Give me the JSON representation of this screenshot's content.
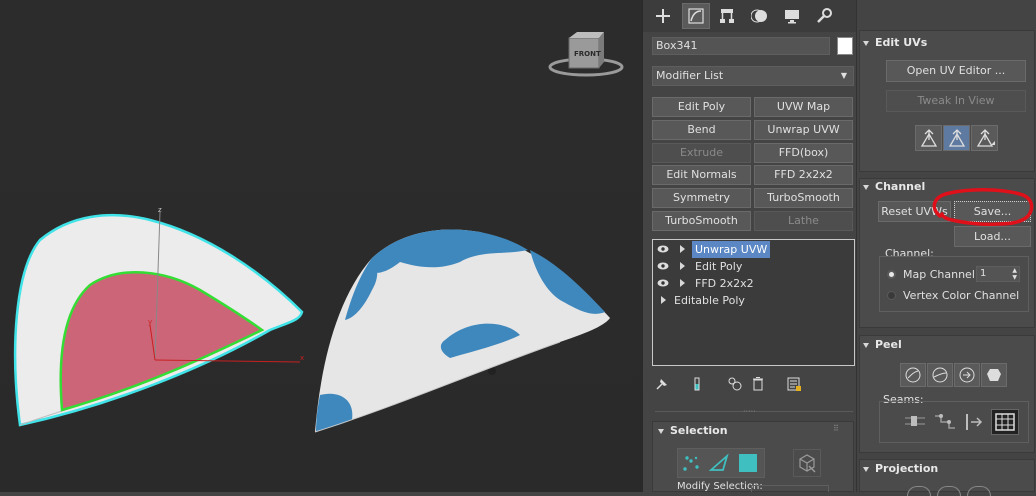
{
  "viewport": {
    "nav_cube_label": "FRONT",
    "axis_z": "z",
    "axis_x": "x",
    "axis_y": "y"
  },
  "command_panel": {
    "tabs": [
      "create",
      "modify",
      "hierarchy",
      "motion",
      "display",
      "utilities"
    ],
    "object_name": "Box341",
    "object_color": "#ffffff",
    "modifier_list_label": "Modifier List",
    "modifier_buttons": [
      {
        "label": "Edit Poly",
        "enabled": true
      },
      {
        "label": "UVW Map",
        "enabled": true
      },
      {
        "label": "Bend",
        "enabled": true
      },
      {
        "label": "Unwrap UVW",
        "enabled": true
      },
      {
        "label": "Extrude",
        "enabled": false
      },
      {
        "label": "FFD(box)",
        "enabled": true
      },
      {
        "label": "Edit Normals",
        "enabled": true
      },
      {
        "label": "FFD 2x2x2",
        "enabled": true
      },
      {
        "label": "Symmetry",
        "enabled": true
      },
      {
        "label": "TurboSmooth",
        "enabled": true
      },
      {
        "label": "TurboSmooth",
        "enabled": true
      },
      {
        "label": "Lathe",
        "enabled": false
      }
    ],
    "stack": [
      {
        "label": "Unwrap UVW",
        "selected": true,
        "eye": true
      },
      {
        "label": "Edit Poly",
        "selected": false,
        "eye": true
      },
      {
        "label": "FFD 2x2x2",
        "selected": false,
        "eye": true
      },
      {
        "label": "Editable Poly",
        "selected": false,
        "eye": false
      }
    ],
    "stack_tools": [
      "pin-stack",
      "show-end-result",
      "make-unique",
      "remove-modifier",
      "configure-modifier-sets"
    ],
    "selection": {
      "title": "Selection",
      "modify_selection_label": "Modify Selection:"
    }
  },
  "right_panel": {
    "edit_uvs": {
      "title": "Edit UVs",
      "open_editor": "Open UV Editor ...",
      "tweak_in_view": "Tweak In View"
    },
    "channel": {
      "title": "Channel",
      "reset_uvws": "Reset UVWs",
      "save": "Save...",
      "load": "Load...",
      "group_label": "Channel:",
      "map_channel_label": "Map Channel:",
      "map_channel_value": "1",
      "vertex_color_label": "Vertex Color Channel",
      "selected_option": "map_channel"
    },
    "peel": {
      "title": "Peel",
      "seams_label": "Seams:"
    },
    "projection": {
      "title": "Projection"
    }
  },
  "colors": {
    "selection_outline": "#3fe3e8",
    "face_selection": "#cc6578",
    "green_edge": "#33dd33",
    "texture_blue": "#3f88bd",
    "annotation_red": "#e0101a",
    "stack_highlight": "#5b87c4",
    "teal_icon": "#3fbfbf"
  }
}
